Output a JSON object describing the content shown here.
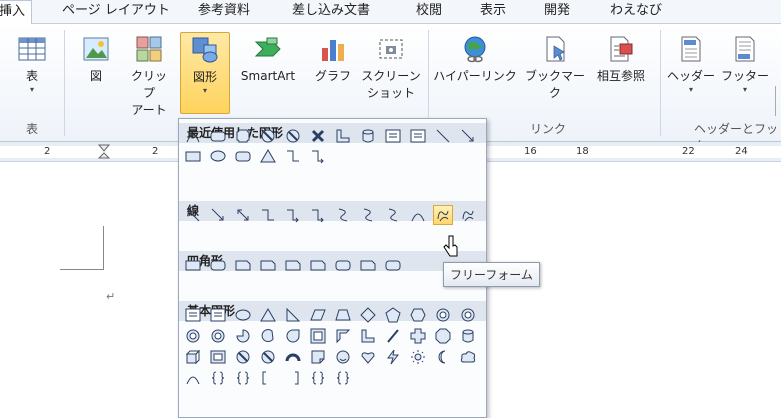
{
  "tabs": [
    "挿入",
    "ページ レイアウト",
    "参考資料",
    "差し込み文書",
    "校閲",
    "表示",
    "開発",
    "わえなび"
  ],
  "ribbon": {
    "table": "表",
    "picture": "図",
    "clipart_1": "クリップ",
    "clipart_2": "アート",
    "shapes": "図形",
    "smartart": "SmartArt",
    "chart": "グラフ",
    "screenshot_1": "スクリーン",
    "screenshot_2": "ショット",
    "hyperlink": "ハイパーリンク",
    "bookmark": "ブックマーク",
    "crossref": "相互参照",
    "header": "ヘッダー",
    "footer": "フッター",
    "group_table": "表",
    "group_links": "リンク",
    "group_headerfooter": "ヘッダーとフッタ"
  },
  "ruler": [
    "2",
    "2",
    "16",
    "18",
    "22",
    "24"
  ],
  "shapes_menu": {
    "recent": "最近使用した図形",
    "lines": "線",
    "rectangles": "四角形",
    "basic": "基本図形"
  },
  "tooltip": "フリーフォーム",
  "paragraph_mark": "↵",
  "colors": {
    "accent": "#ffd35d",
    "section_bg": "#dfe5ee",
    "shape_stroke": "#2b3f63",
    "shape_fill": "#dfe8f5"
  }
}
